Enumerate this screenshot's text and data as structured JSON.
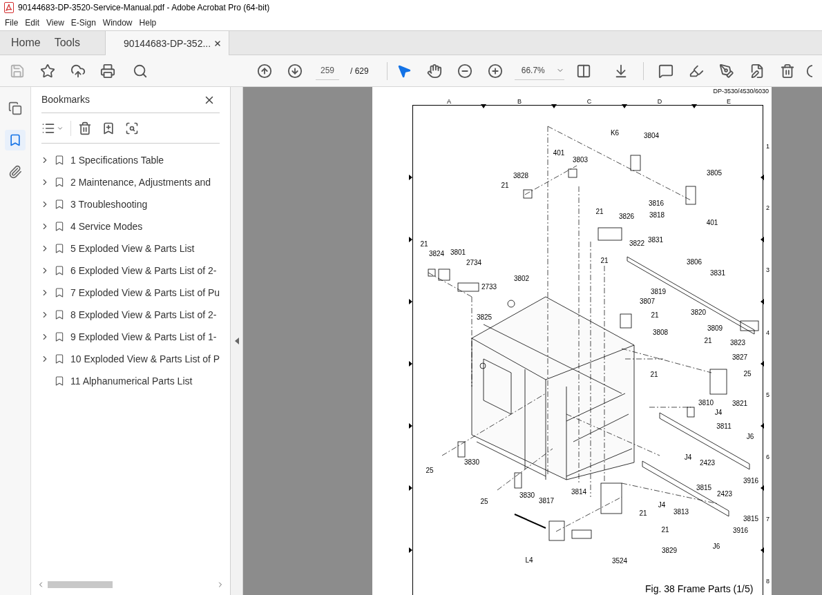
{
  "window": {
    "title": "90144683-DP-3520-Service-Manual.pdf - Adobe Acrobat Pro (64-bit)"
  },
  "menu": [
    "File",
    "Edit",
    "View",
    "E-Sign",
    "Window",
    "Help"
  ],
  "tabs": [
    {
      "label": "Home",
      "selected": false
    },
    {
      "label": "Tools",
      "selected": false
    },
    {
      "label": "90144683-DP-352...",
      "selected": true
    }
  ],
  "toolbar": {
    "page": "259",
    "page_count": "/ 629",
    "zoom": "66.7%"
  },
  "side_rail": [
    {
      "kind": "pages",
      "selected": false
    },
    {
      "kind": "bookmarks",
      "selected": true
    },
    {
      "kind": "attachments",
      "selected": false
    }
  ],
  "bookmarks": {
    "title": "Bookmarks",
    "items": [
      {
        "label": "1 Specifications Table",
        "kind": "branch"
      },
      {
        "label": "2 Maintenance, Adjustments and",
        "kind": "branch"
      },
      {
        "label": "3 Troubleshooting",
        "kind": "branch"
      },
      {
        "label": "4 Service Modes",
        "kind": "branch"
      },
      {
        "label": "5 Exploded View & Parts List",
        "kind": "branch"
      },
      {
        "label": "6 Exploded View & Parts List of 2-",
        "kind": "branch"
      },
      {
        "label": "7 Exploded View & Parts List of Pu",
        "kind": "branch"
      },
      {
        "label": "8 Exploded View & Parts List of 2-",
        "kind": "branch"
      },
      {
        "label": "9 Exploded View & Parts List of 1-",
        "kind": "branch"
      },
      {
        "label": "10 Exploded View & Parts List of P",
        "kind": "branch"
      },
      {
        "label": "11 Alphanumerical Parts List",
        "kind": "leaf"
      }
    ]
  },
  "document": {
    "header": "DP-3530/4530/6030",
    "columns": [
      "A",
      "B",
      "C",
      "D",
      "E"
    ],
    "rows": [
      "1",
      "2",
      "3",
      "4",
      "5",
      "6",
      "7",
      "8"
    ],
    "callouts": [
      "K6",
      "3804",
      "401",
      "3803",
      "3805",
      "3828",
      "21",
      "3816",
      "21",
      "3826",
      "3818",
      "401",
      "21",
      "3824",
      "3801",
      "2734",
      "3822",
      "3831",
      "21",
      "3806",
      "3831",
      "3802",
      "2733",
      "3819",
      "3807",
      "3825",
      "21",
      "3820",
      "3808",
      "3809",
      "3823",
      "21",
      "3827",
      "25",
      "21",
      "3821",
      "3810",
      "J4",
      "3811",
      "J6",
      "J4",
      "2423",
      "3830",
      "25",
      "3916",
      "3815",
      "2423",
      "25",
      "3830",
      "3814",
      "3817",
      "J4",
      "3813",
      "21",
      "3815",
      "21",
      "3916",
      "J6",
      "3829",
      "L4",
      "3524"
    ],
    "caption": "Fig. 38 Frame Parts (1/5)"
  }
}
